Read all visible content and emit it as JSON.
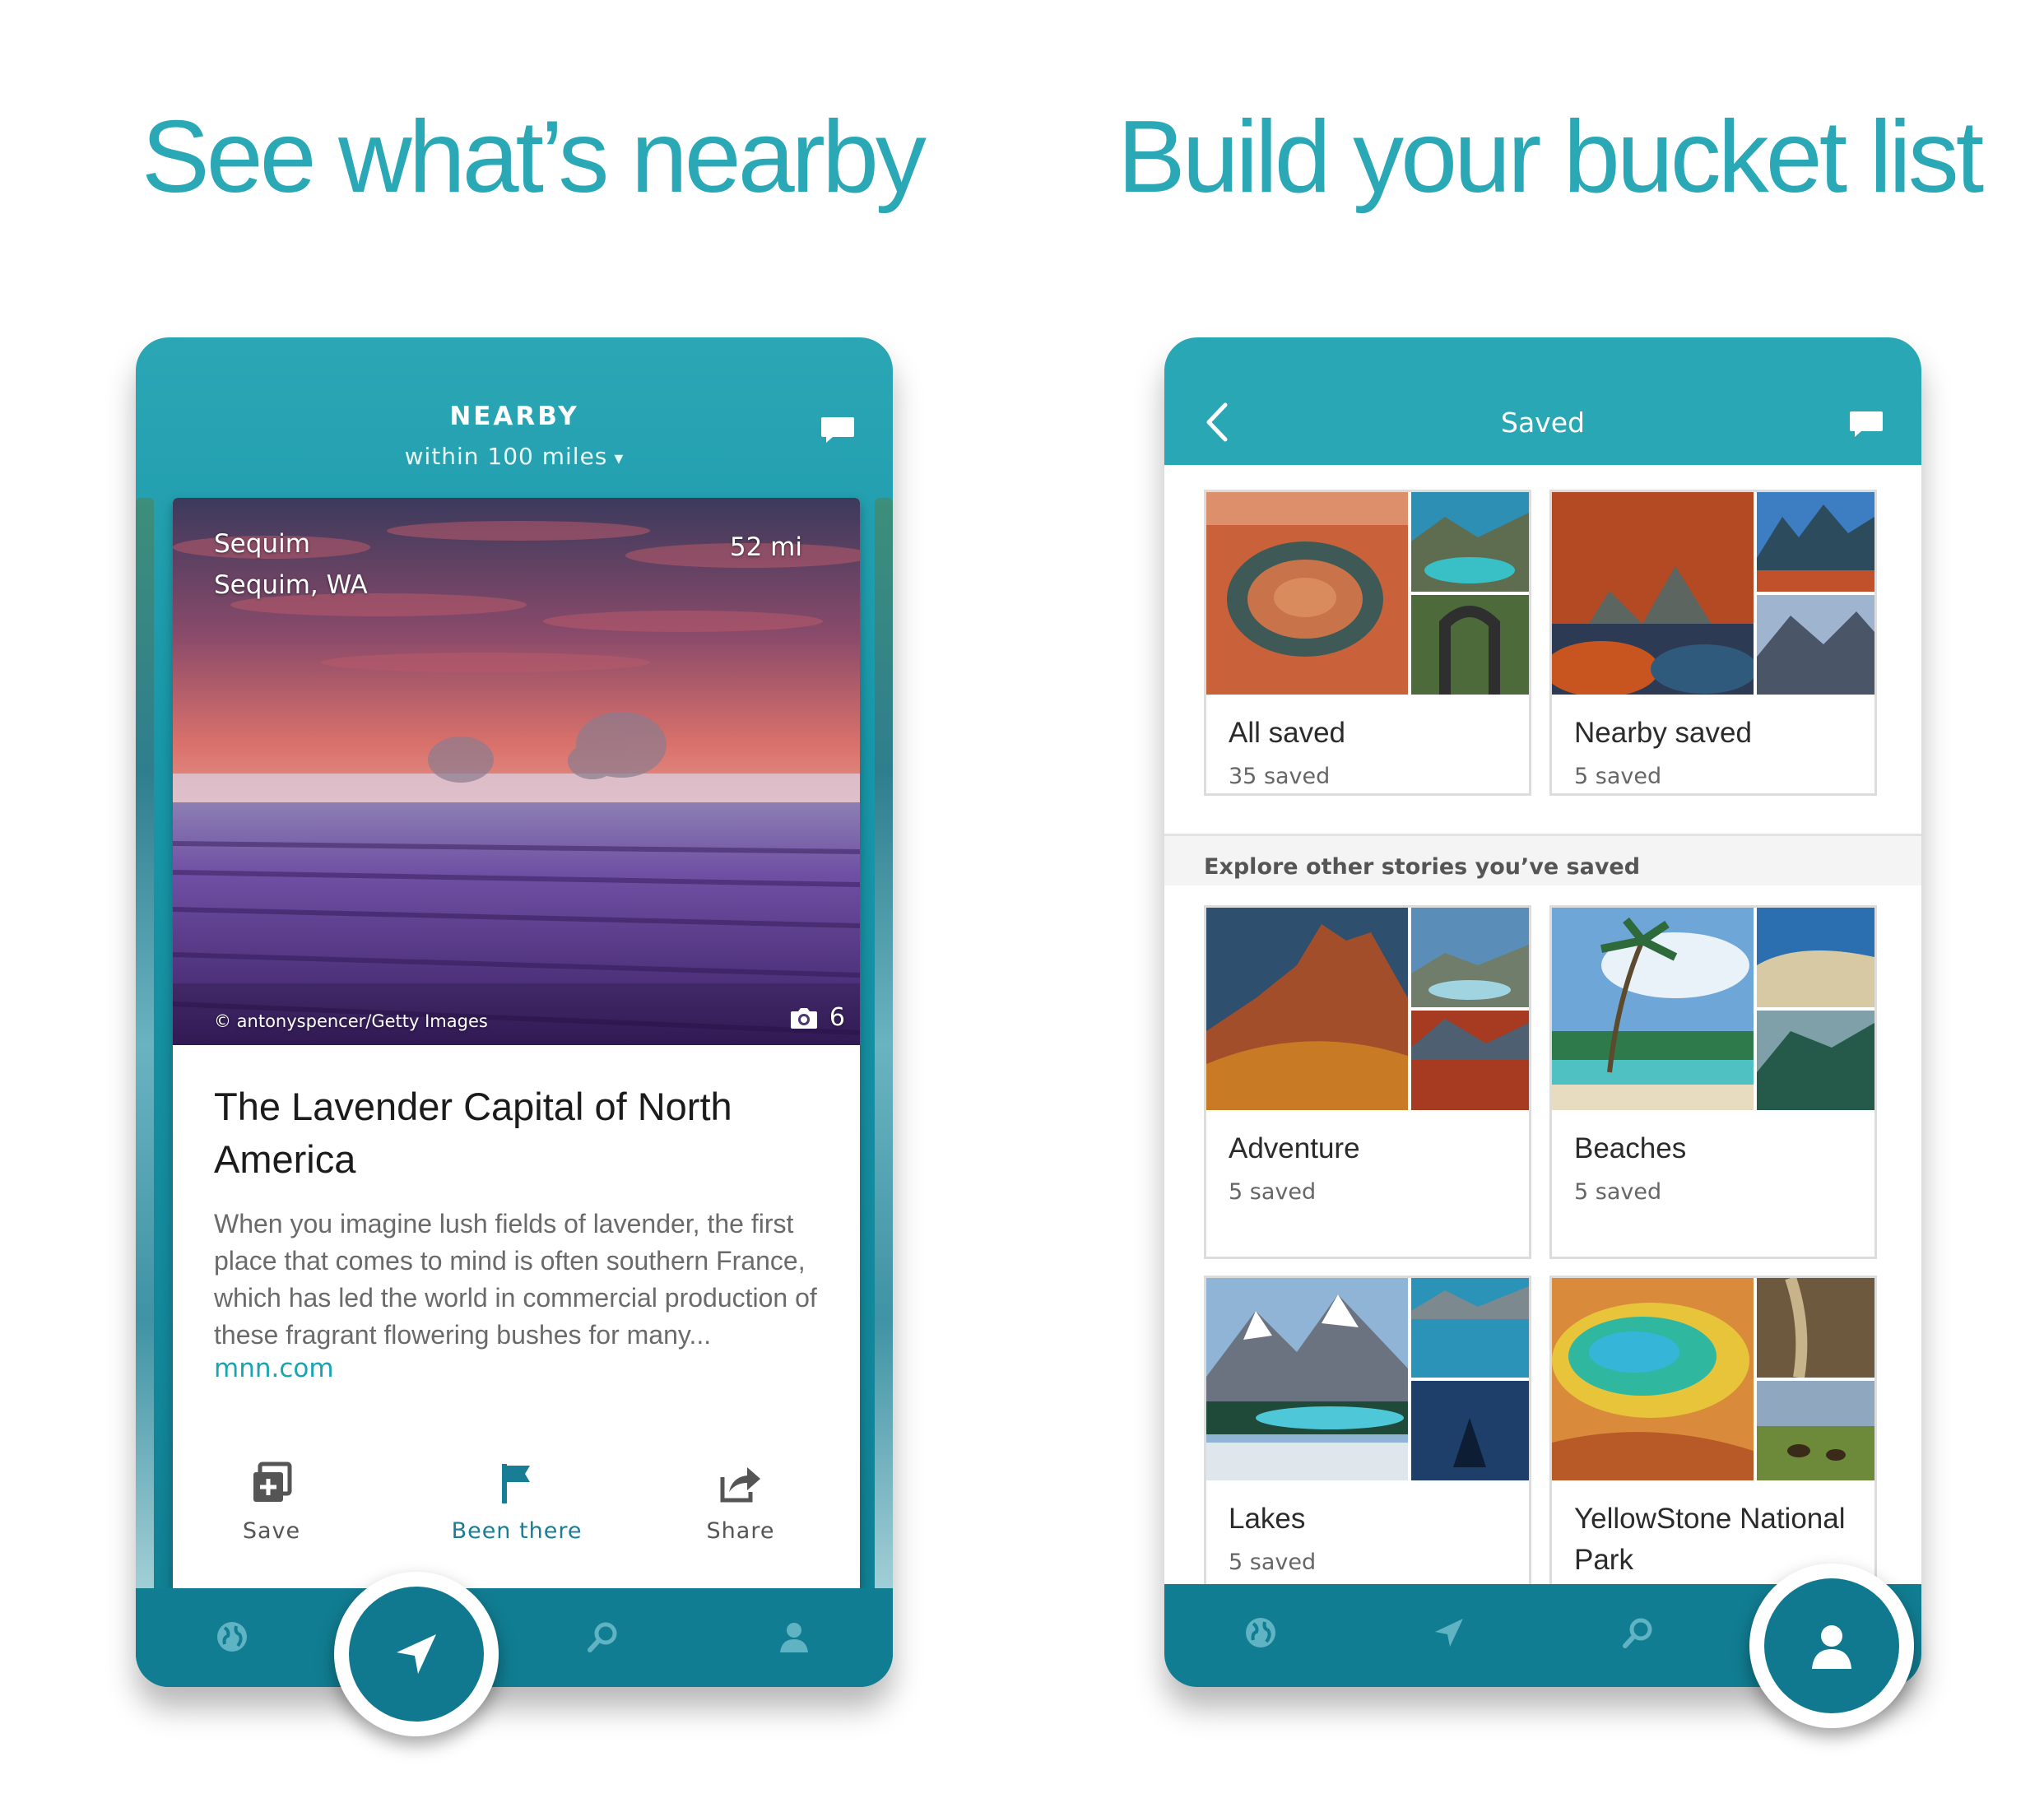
{
  "headlines": {
    "left": "See what’s nearby",
    "right": "Build your bucket list"
  },
  "nearby_screen": {
    "title": "NEARBY",
    "subtitle": "within 100 miles",
    "caret": "▾",
    "story": {
      "place_name": "Sequim",
      "place_state": "Sequim, WA",
      "distance": "52 mi",
      "photo_credit": "© antonyspencer/Getty Images",
      "photo_count": "6",
      "title": "The Lavender Capital of North America",
      "body": "When you imagine lush fields of lavender, the first place that comes to mind is often southern France, which has led the world in commercial production of these fragrant flowering bushes for many...",
      "source": "mnn.com"
    },
    "actions": [
      {
        "label": "Save",
        "icon": "add-collection-icon"
      },
      {
        "label": "Been there",
        "icon": "flag-icon"
      },
      {
        "label": "Share",
        "icon": "share-icon"
      }
    ],
    "nav": [
      "globe-icon",
      "navigate-icon",
      "search-icon",
      "profile-icon"
    ]
  },
  "saved_screen": {
    "title": "Saved",
    "section_label": "Explore other stories you’ve saved",
    "top_collections": [
      {
        "label": "All saved",
        "count": "35 saved"
      },
      {
        "label": "Nearby saved",
        "count": "5 saved"
      }
    ],
    "story_collections": [
      {
        "label": "Adventure",
        "count": "5 saved"
      },
      {
        "label": "Beaches",
        "count": "5 saved"
      },
      {
        "label": "Lakes",
        "count": "5 saved"
      },
      {
        "label": "YellowStone National Park",
        "count": ""
      }
    ],
    "nav": [
      "globe-icon",
      "navigate-icon",
      "search-icon",
      "profile-icon"
    ]
  },
  "colors": {
    "accent": "#2aa8b6",
    "nav_dark": "#117d92",
    "link": "#19a4b4"
  }
}
